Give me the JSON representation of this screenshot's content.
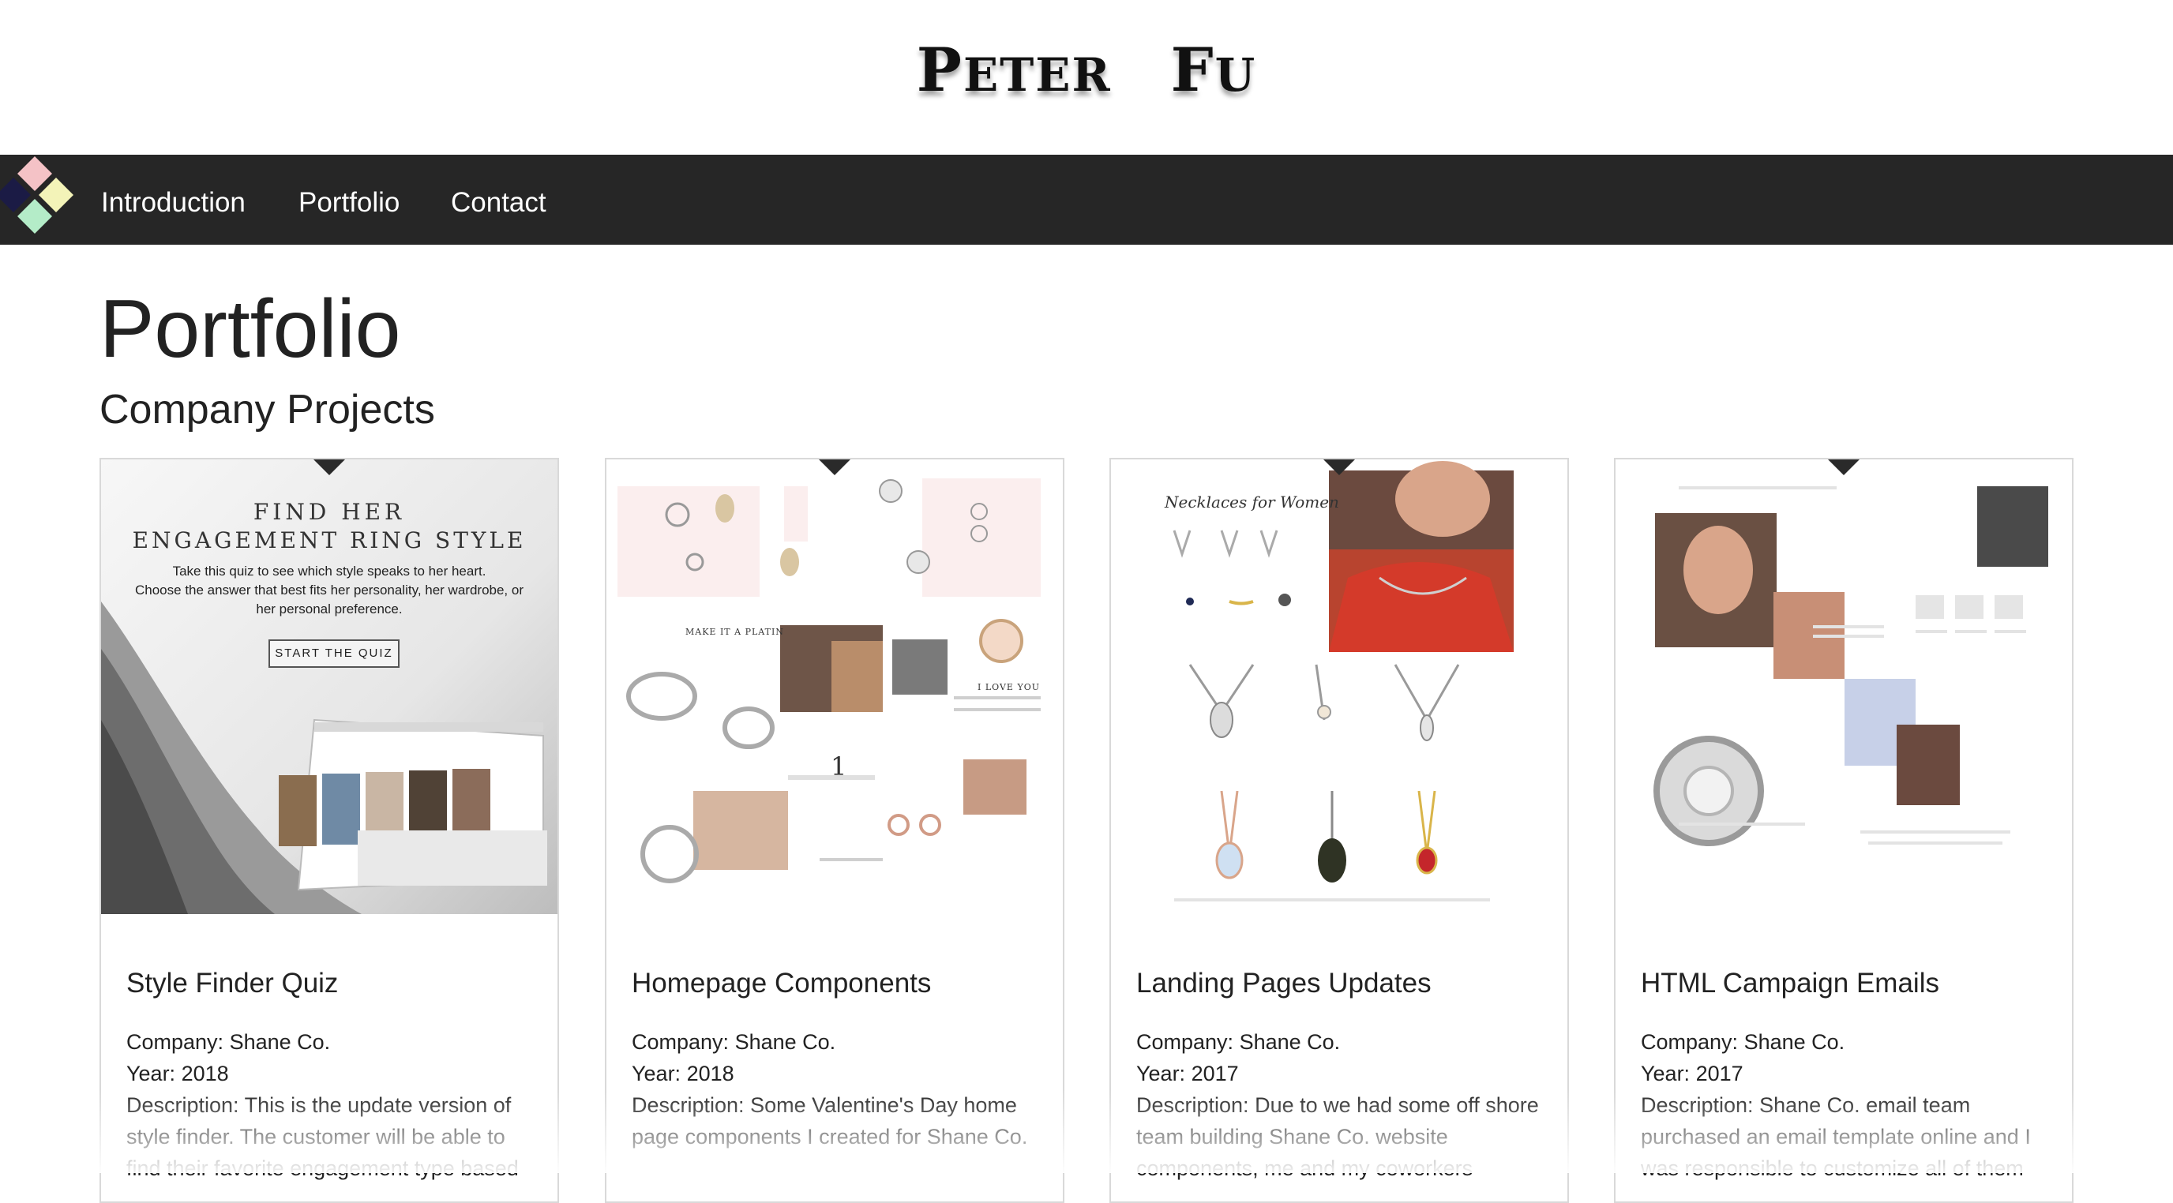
{
  "header": {
    "logo_first_initial": "P",
    "logo_first_rest": "ETER",
    "logo_last_initial": "F",
    "logo_last_rest": "U"
  },
  "nav": {
    "items": [
      {
        "label": "Introduction"
      },
      {
        "label": "Portfolio"
      },
      {
        "label": "Contact"
      }
    ],
    "logo_colors": [
      "#f4c2c6",
      "#f3f3b8",
      "#b4ecc8",
      "#1b1b45"
    ]
  },
  "main": {
    "title": "Portfolio",
    "section_title": "Company Projects"
  },
  "cards": [
    {
      "title": "Style Finder Quiz",
      "company_label": "Company:",
      "company": " Shane Co.",
      "year_label": "Year:",
      "year": " 2018",
      "desc_label": "Description:",
      "desc": " This is the update version of style finder. The customer will be able to find their favorite engagement type based",
      "img": {
        "heading1": "FIND HER",
        "heading2": "ENGAGEMENT RING STYLE",
        "line1": "Take this quiz to see which style speaks to her heart.",
        "line2": "Choose the answer that best fits her personality, her wardrobe, or",
        "line3": "her personal preference.",
        "button": "START THE QUIZ"
      }
    },
    {
      "title": "Homepage Components",
      "company_label": "Company:",
      "company": " Shane Co.",
      "year_label": "Year:",
      "year": " 2018",
      "desc_label": "Description:",
      "desc": " Some Valentine's Day home page components I created for Shane Co.",
      "img": {
        "caption1": "MAKE IT A PLATIN",
        "caption2": "I LOVE YOU",
        "number": "1"
      }
    },
    {
      "title": "Landing Pages Updates",
      "company_label": "Company:",
      "company": " Shane Co.",
      "year_label": "Year:",
      "year": " 2017",
      "desc_label": "Description:",
      "desc": " Due to we had some off shore team building Shane Co. website components, me and my coworkers",
      "img": {
        "heading": "Necklaces for Women"
      }
    },
    {
      "title": "HTML Campaign Emails",
      "company_label": "Company:",
      "company": " Shane Co.",
      "year_label": "Year:",
      "year": " 2017",
      "desc_label": "Description:",
      "desc": " Shane Co. email team purchased an email template online and I was responsible to customize all of them",
      "img": {}
    }
  ]
}
